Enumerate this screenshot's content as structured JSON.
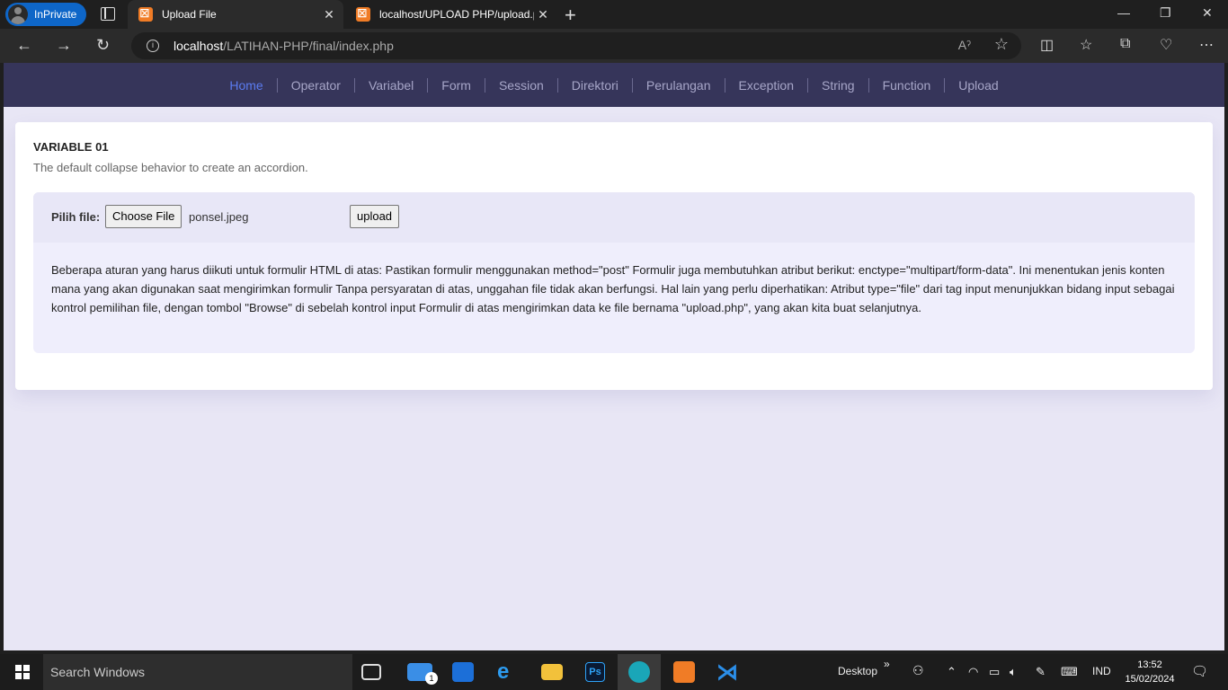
{
  "browser": {
    "inprivate_label": "InPrivate",
    "tabs": [
      {
        "title": "Upload File",
        "close": "✕"
      },
      {
        "title": "localhost/UPLOAD PHP/upload.p",
        "close": "✕"
      }
    ],
    "newtab": "+",
    "controls": {
      "min": "—",
      "max": "❐",
      "close": "✕"
    },
    "url_host": "localhost",
    "url_path": "/LATIHAN-PHP/final/index.php",
    "back": "←",
    "forward": "→",
    "reload": "↻",
    "read_aloud": "Aˀ",
    "favorite_star": "☆"
  },
  "nav": {
    "items": [
      "Home",
      "Operator",
      "Variabel",
      "Form",
      "Session",
      "Direktori",
      "Perulangan",
      "Exception",
      "String",
      "Function",
      "Upload"
    ]
  },
  "card": {
    "title": "VARIABLE 01",
    "subtitle": "The default collapse behavior to create an accordion.",
    "form_label": "Pilih file:",
    "choose_button": "Choose File",
    "file_name": "ponsel.jpeg",
    "upload_button": "upload",
    "paragraph": "Beberapa aturan yang harus diikuti untuk formulir HTML di atas: Pastikan formulir menggunakan method=\"post\" Formulir juga membutuhkan atribut berikut: enctype=\"multipart/form-data\". Ini menentukan jenis konten mana yang akan digunakan saat mengirimkan formulir Tanpa persyaratan di atas, unggahan file tidak akan berfungsi. Hal lain yang perlu diperhatikan: Atribut type=\"file\" dari tag input menunjukkan bidang input sebagai kontrol pemilihan file, dengan tombol \"Browse\" di sebelah kontrol input Formulir di atas mengirimkan data ke file bernama \"upload.php\", yang akan kita buat selanjutnya."
  },
  "taskbar": {
    "search_placeholder": "Search Windows",
    "desktop_label": "Desktop",
    "desktop_chevron": "»",
    "language": "IND",
    "time": "13:52",
    "date": "15/02/2024",
    "mail_badge": "1"
  },
  "colors": {
    "nav_bg": "#36355a",
    "nav_active": "#5b7cf0",
    "page_bg": "#e8e6f5",
    "inprivate": "#0e66c8"
  }
}
